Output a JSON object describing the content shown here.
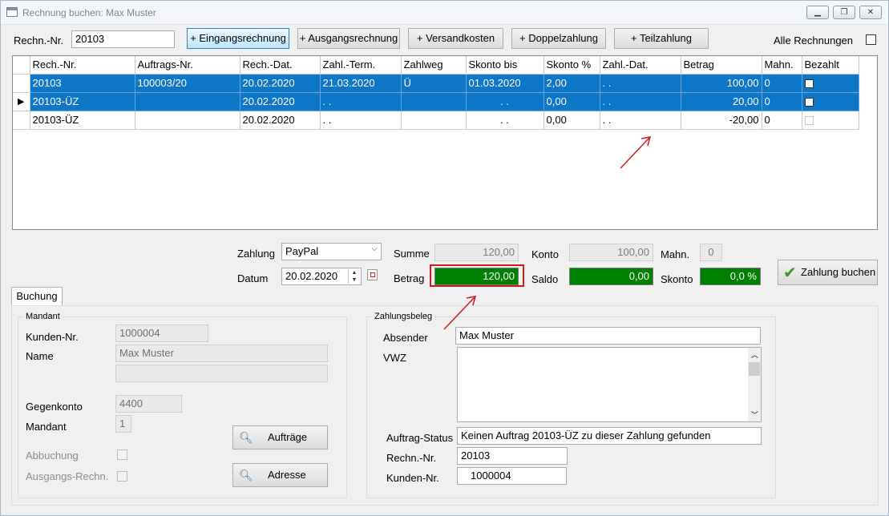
{
  "window": {
    "title": "Rechnung buchen: Max Muster"
  },
  "top": {
    "rechn_label": "Rechn.-Nr.",
    "rechn_value": "20103",
    "buttons": [
      "+ Eingangsrechnung",
      "+ Ausgangsrechnung",
      "+ Versandkosten",
      "+ Doppelzahlung",
      "+ Teilzahlung"
    ],
    "alle_label": "Alle Rechnungen"
  },
  "grid": {
    "columns": [
      "Rech.-Nr.",
      "Auftrags-Nr.",
      "Rech.-Dat.",
      "Zahl.-Term.",
      "Zahlweg",
      "Skonto bis",
      "Skonto %",
      "Zahl.-Dat.",
      "Betrag",
      "Mahn.",
      "Bezahlt"
    ],
    "rows": [
      {
        "rech_nr": "20103",
        "auftrags_nr": "100003/20",
        "rech_dat": "20.02.2020",
        "zahl_term": "21.03.2020",
        "zahlweg": "Ü",
        "skonto_bis": "01.03.2020",
        "skonto_pct": "2,00",
        "zahl_dat": ". .",
        "betrag": "100,00",
        "mahn": "0",
        "indicator": "",
        "selected": true
      },
      {
        "rech_nr": "20103-ÜZ",
        "auftrags_nr": "",
        "rech_dat": "20.02.2020",
        "zahl_term": ". .",
        "zahlweg": "",
        "skonto_bis": ". .",
        "skonto_pct": "0,00",
        "zahl_dat": ". .",
        "betrag": "20,00",
        "mahn": "0",
        "indicator": "▶",
        "selected": true
      },
      {
        "rech_nr": "20103-ÜZ",
        "auftrags_nr": "",
        "rech_dat": "20.02.2020",
        "zahl_term": ". .",
        "zahlweg": "",
        "skonto_bis": ". .",
        "skonto_pct": "0,00",
        "zahl_dat": ". .",
        "betrag": "-20,00",
        "mahn": "0",
        "indicator": "",
        "selected": false
      }
    ]
  },
  "payment": {
    "zahlung_label": "Zahlung",
    "zahlung_value": "PayPal",
    "datum_label": "Datum",
    "datum_value": "20.02.2020",
    "summe_label": "Summe",
    "summe_value": "120,00",
    "betrag_label": "Betrag",
    "betrag_value": "120,00",
    "konto_label": "Konto",
    "konto_value": "100,00",
    "saldo_label": "Saldo",
    "saldo_value": "0,00",
    "mahn_label": "Mahn.",
    "mahn_value": "0",
    "skonto_label": "Skonto",
    "skonto_value": "0,0 %",
    "buchen_button": "Zahlung buchen"
  },
  "tab": {
    "label": "Buchung"
  },
  "mandant": {
    "title": "Mandant",
    "kunden_label": "Kunden-Nr.",
    "kunden_value": "1000004",
    "name_label": "Name",
    "name_value": "Max Muster",
    "name2_value": "",
    "gegenkonto_label": "Gegenkonto",
    "gegenkonto_value": "4400",
    "mandant_label": "Mandant",
    "mandant_value": "1",
    "abbuchung_label": "Abbuchung",
    "ausgangs_label": "Ausgangs-Rechn.",
    "auftraege_button": "Aufträge",
    "adresse_button": "Adresse"
  },
  "zahlungsbeleg": {
    "title": "Zahlungsbeleg",
    "absender_label": "Absender",
    "absender_value": "Max Muster",
    "vwz_label": "VWZ",
    "vwz_value": "",
    "status_label": "Auftrag-Status",
    "status_value": "Keinen Auftrag 20103-ÜZ zu dieser Zahlung gefunden",
    "rechn_label": "Rechn.-Nr.",
    "rechn_value": "20103",
    "kunden_label": "Kunden-Nr.",
    "kunden_value": "1000004"
  },
  "colors": {
    "selection": "#0f77c8",
    "green_field": "#008000",
    "highlight_box": "#c81e1e"
  }
}
